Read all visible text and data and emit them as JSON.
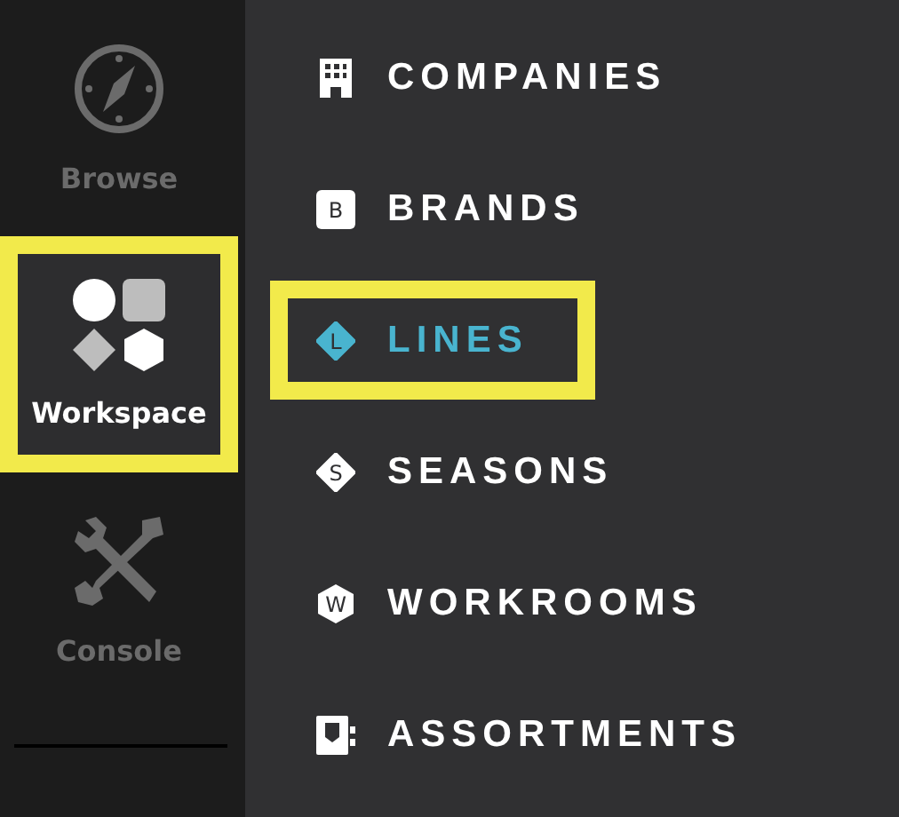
{
  "rail": {
    "items": [
      {
        "label": "Browse",
        "kind": "compass",
        "selected": false,
        "highlighted": false
      },
      {
        "label": "Workspace",
        "kind": "shapes",
        "selected": true,
        "highlighted": true
      },
      {
        "label": "Console",
        "kind": "tools",
        "selected": false,
        "highlighted": false
      }
    ]
  },
  "menu": {
    "items": [
      {
        "label": "COMPANIES",
        "kind": "building",
        "selected": false,
        "highlighted": false
      },
      {
        "label": "BRANDS",
        "kind": "square",
        "badge": "B",
        "selected": false,
        "highlighted": false
      },
      {
        "label": "LINES",
        "kind": "diamond",
        "badge": "L",
        "selected": true,
        "highlighted": true
      },
      {
        "label": "SEASONS",
        "kind": "diamond",
        "badge": "S",
        "selected": false,
        "highlighted": false
      },
      {
        "label": "WORKROOMS",
        "kind": "hexagon",
        "badge": "W",
        "selected": false,
        "highlighted": false
      },
      {
        "label": "ASSORTMENTS",
        "kind": "board",
        "selected": false,
        "highlighted": false
      }
    ]
  }
}
